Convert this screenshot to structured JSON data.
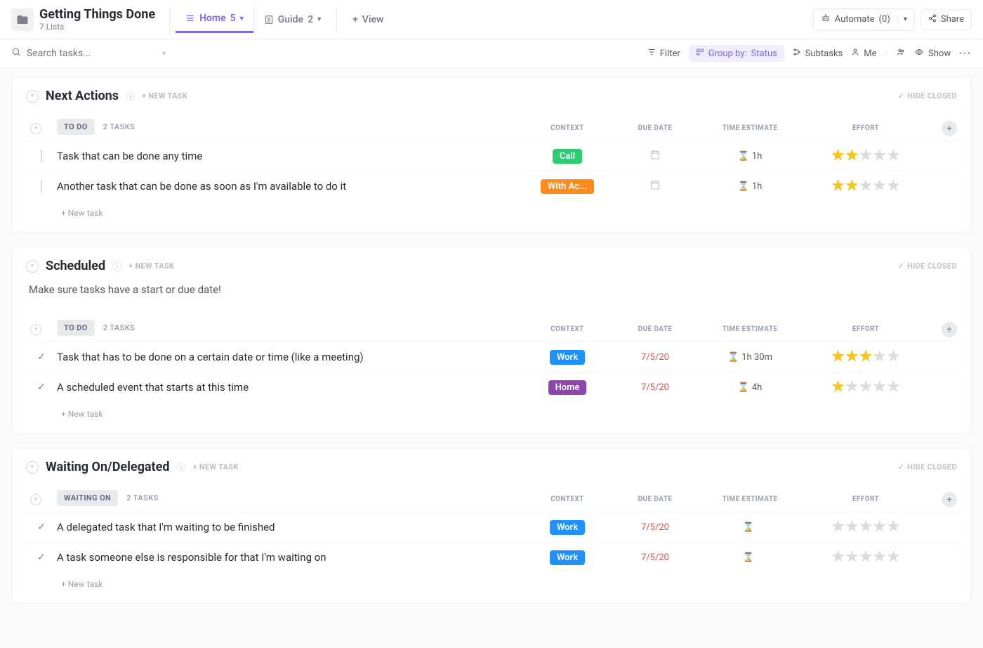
{
  "header": {
    "title": "Getting Things Done",
    "subtitle": "7 Lists",
    "tabs": [
      {
        "label": "Home",
        "count": "5",
        "active": true
      },
      {
        "label": "Guide",
        "count": "2",
        "active": false
      }
    ],
    "add_view": "View",
    "automate_label": "Automate",
    "automate_count": "(0)",
    "share_label": "Share"
  },
  "toolbar": {
    "search_placeholder": "Search tasks...",
    "filter": "Filter",
    "group_by_label": "Group by:",
    "group_by_value": "Status",
    "subtasks": "Subtasks",
    "me": "Me",
    "show": "Show"
  },
  "columns": {
    "context": "CONTEXT",
    "due_date": "DUE DATE",
    "time_estimate": "TIME ESTIMATE",
    "effort": "EFFORT"
  },
  "labels": {
    "new_task": "+ NEW TASK",
    "hide_closed": "HIDE CLOSED",
    "plus_new_task": "+ New task"
  },
  "tag_colors": {
    "Call": "#2ecc71",
    "With Ac...": "#ff8c1a",
    "Work": "#1e90ff",
    "Home": "#8e44ad"
  },
  "sections": [
    {
      "title": "Next Actions",
      "description": "",
      "groups": [
        {
          "status_label": "TO DO",
          "count_label": "2 TASKS",
          "status_icon": "square",
          "rows": [
            {
              "name": "Task that can be done any time",
              "context": "Call",
              "due": "",
              "estimate": "1h",
              "effort": 2
            },
            {
              "name": "Another task that can be done as soon as I'm available to do it",
              "context": "With Ac...",
              "due": "",
              "estimate": "1h",
              "effort": 2
            }
          ]
        }
      ]
    },
    {
      "title": "Scheduled",
      "description": "Make sure tasks have a start or due date!",
      "groups": [
        {
          "status_label": "TO DO",
          "count_label": "2 TASKS",
          "status_icon": "check",
          "rows": [
            {
              "name": "Task that has to be done on a certain date or time (like a meeting)",
              "context": "Work",
              "due": "7/5/20",
              "estimate": "1h 30m",
              "effort": 3
            },
            {
              "name": "A scheduled event that starts at this time",
              "context": "Home",
              "due": "7/5/20",
              "estimate": "4h",
              "effort": 1
            }
          ]
        }
      ]
    },
    {
      "title": "Waiting On/Delegated",
      "description": "",
      "groups": [
        {
          "status_label": "WAITING ON",
          "count_label": "2 TASKS",
          "status_icon": "check",
          "rows": [
            {
              "name": "A delegated task that I'm waiting to be finished",
              "context": "Work",
              "due": "7/5/20",
              "estimate": "",
              "effort": 0
            },
            {
              "name": "A task someone else is responsible for that I'm waiting on",
              "context": "Work",
              "due": "7/5/20",
              "estimate": "",
              "effort": 0
            }
          ]
        }
      ]
    }
  ]
}
